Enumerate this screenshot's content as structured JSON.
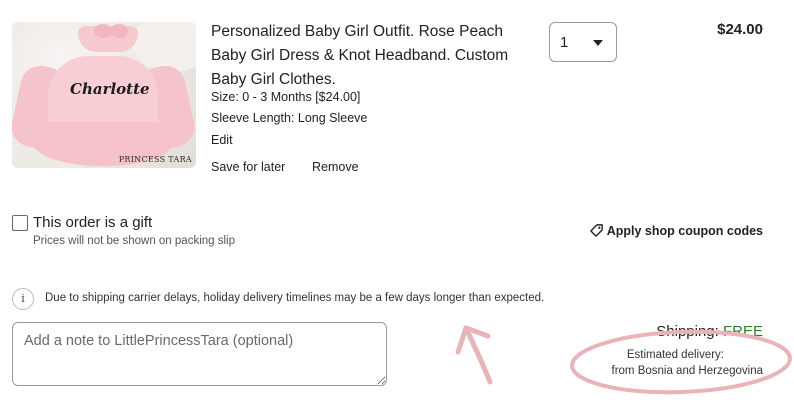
{
  "product": {
    "image_text": "Charlotte",
    "image_brand": "PRINCESS TARA",
    "title": "Personalized Baby Girl Outfit. Rose Peach Baby Girl Dress & Knot Headband. Custom Baby Girl Clothes.",
    "size": "Size: 0 - 3 Months [$24.00]",
    "sleeve": "Sleeve Length: Long Sleeve",
    "edit_label": "Edit",
    "save_label": "Save for later",
    "remove_label": "Remove",
    "quantity": "1",
    "price": "$24.00"
  },
  "gift": {
    "label": "This order is a gift",
    "sublabel": "Prices will not be shown on packing slip"
  },
  "coupon": {
    "label": "Apply shop coupon codes",
    "icon": "tag-icon"
  },
  "notice": {
    "icon": "info-icon",
    "icon_glyph": "i",
    "text": "Due to shipping carrier delays, holiday delivery timelines may be a few days longer than expected."
  },
  "note": {
    "placeholder": "Add a note to LittlePrincessTara (optional)"
  },
  "shipping": {
    "label": "Shipping: ",
    "value": "FREE",
    "estimated_label": "Estimated delivery:",
    "from": "from Bosnia and Herzegovina"
  },
  "colors": {
    "free": "#2e7d32",
    "annotation": "#e8b4b8"
  }
}
